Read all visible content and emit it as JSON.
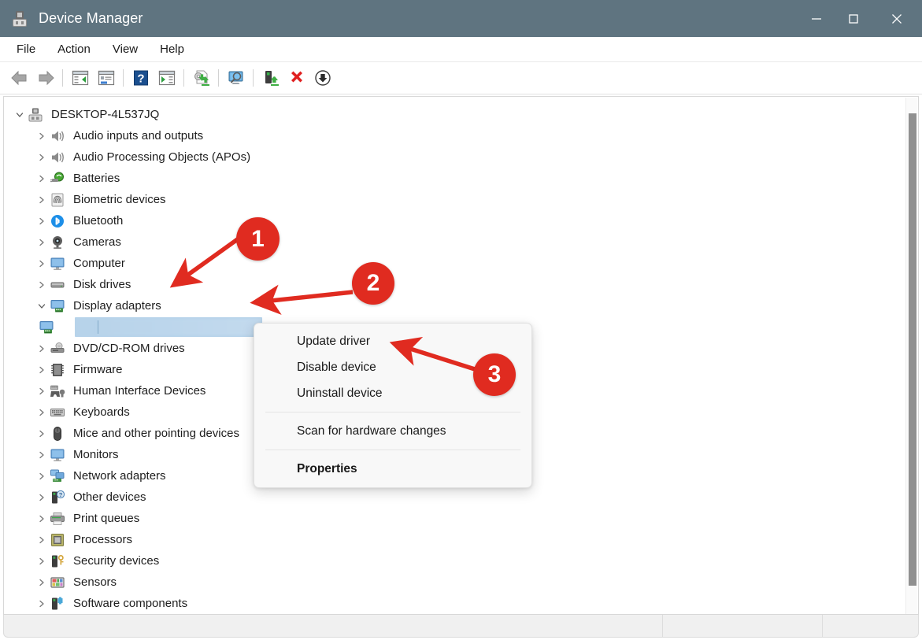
{
  "window": {
    "title": "Device Manager",
    "icon": "device-manager-icon",
    "titlebar_color": "#5f7480",
    "controls": [
      {
        "name": "minimize",
        "glyph": "minimize-icon"
      },
      {
        "name": "maximize",
        "glyph": "maximize-icon"
      },
      {
        "name": "close",
        "glyph": "close-icon"
      }
    ]
  },
  "menubar": {
    "items": [
      {
        "label": "File"
      },
      {
        "label": "Action"
      },
      {
        "label": "View"
      },
      {
        "label": "Help"
      }
    ]
  },
  "toolbar": {
    "buttons": [
      {
        "name": "back-button",
        "icon": "back-arrow-icon"
      },
      {
        "name": "forward-button",
        "icon": "forward-arrow-icon"
      },
      {
        "name": "show-hide-console-tree-button",
        "icon": "console-tree-icon"
      },
      {
        "name": "properties-button",
        "icon": "properties-window-icon"
      },
      {
        "name": "help-button",
        "icon": "question-mark-icon"
      },
      {
        "name": "show-hide-action-pane-button",
        "icon": "action-pane-icon"
      },
      {
        "name": "update-driver-button",
        "icon": "update-driver-icon"
      },
      {
        "name": "scan-for-hardware-changes-button",
        "icon": "scan-monitor-icon"
      },
      {
        "name": "enable-device-button",
        "icon": "enable-device-icon"
      },
      {
        "name": "uninstall-device-button",
        "icon": "red-x-icon"
      },
      {
        "name": "disable-device-button",
        "icon": "down-arrow-circle-icon"
      }
    ]
  },
  "tree": {
    "root": {
      "label": "DESKTOP-4L537JQ",
      "icon": "computer-node-icon",
      "expanded": true
    },
    "nodes": [
      {
        "label": "Audio inputs and outputs",
        "icon": "speaker-icon",
        "expanded": false
      },
      {
        "label": "Audio Processing Objects (APOs)",
        "icon": "speaker-icon",
        "expanded": false
      },
      {
        "label": "Batteries",
        "icon": "battery-icon",
        "expanded": false
      },
      {
        "label": "Biometric devices",
        "icon": "fingerprint-icon",
        "expanded": false
      },
      {
        "label": "Bluetooth",
        "icon": "bluetooth-icon",
        "expanded": false
      },
      {
        "label": "Cameras",
        "icon": "camera-icon",
        "expanded": false
      },
      {
        "label": "Computer",
        "icon": "monitor-icon",
        "expanded": false
      },
      {
        "label": "Disk drives",
        "icon": "disk-drive-icon",
        "expanded": false
      },
      {
        "label": "Display adapters",
        "icon": "display-adapter-icon",
        "expanded": true
      },
      {
        "label": "",
        "icon": "display-adapter-icon",
        "child": true,
        "selected": true,
        "redacted": true
      },
      {
        "label": "DVD/CD-ROM drives",
        "icon": "dvd-drive-icon",
        "expanded": false
      },
      {
        "label": "Firmware",
        "icon": "firmware-chip-icon",
        "expanded": false
      },
      {
        "label": "Human Interface Devices",
        "icon": "hid-icon",
        "expanded": false
      },
      {
        "label": "Keyboards",
        "icon": "keyboard-icon",
        "expanded": false
      },
      {
        "label": "Mice and other pointing devices",
        "icon": "mouse-icon",
        "expanded": false
      },
      {
        "label": "Monitors",
        "icon": "monitor-icon",
        "expanded": false
      },
      {
        "label": "Network adapters",
        "icon": "network-adapter-icon",
        "expanded": false
      },
      {
        "label": "Other devices",
        "icon": "unknown-device-icon",
        "expanded": false
      },
      {
        "label": "Print queues",
        "icon": "printer-icon",
        "expanded": false
      },
      {
        "label": "Processors",
        "icon": "processor-icon",
        "expanded": false
      },
      {
        "label": "Security devices",
        "icon": "security-device-icon",
        "expanded": false
      },
      {
        "label": "Sensors",
        "icon": "sensors-icon",
        "expanded": false
      },
      {
        "label": "Software components",
        "icon": "software-component-icon",
        "expanded": false
      }
    ]
  },
  "context_menu": {
    "items": [
      {
        "label": "Update driver",
        "bold": false
      },
      {
        "label": "Disable device",
        "bold": false
      },
      {
        "label": "Uninstall device",
        "bold": false
      },
      {
        "separator": true
      },
      {
        "label": "Scan for hardware changes",
        "bold": false
      },
      {
        "separator": true
      },
      {
        "label": "Properties",
        "bold": true
      }
    ]
  },
  "annotations": {
    "color": "#e02b20",
    "markers": [
      {
        "number": "1",
        "points_to": "disk-drives-row"
      },
      {
        "number": "2",
        "points_to": "display-adapters-row"
      },
      {
        "number": "3",
        "points_to": "update-driver-menu-item"
      }
    ]
  },
  "statusbar": {
    "text": ""
  }
}
